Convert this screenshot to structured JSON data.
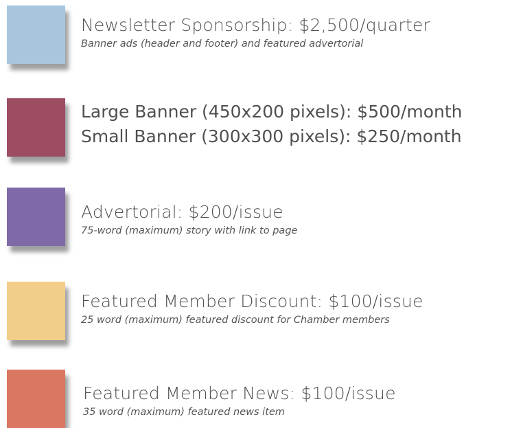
{
  "colors": {
    "swatch_1": "#a7c6dd",
    "swatch_2": "#9c4d62",
    "swatch_3": "#7f69a6",
    "swatch_4": "#f3cd8a",
    "swatch_5": "#d97760"
  },
  "items": [
    {
      "title": "Newsletter Sponsorship: $2,500/quarter",
      "description": "Banner ads (header and footer) and featured advertorial"
    },
    {
      "title": "Large Banner (450x200 pixels): $500/month",
      "title2": "Small Banner (300x300 pixels): $250/month"
    },
    {
      "title": "Advertorial: $200/issue",
      "description": "75-word (maximum) story with link to page"
    },
    {
      "title": "Featured Member Discount: $100/issue",
      "description": "25 word (maximum) featured discount for Chamber members"
    },
    {
      "title": "Featured Member News: $100/issue",
      "description": "35 word (maximum) featured news item"
    }
  ]
}
